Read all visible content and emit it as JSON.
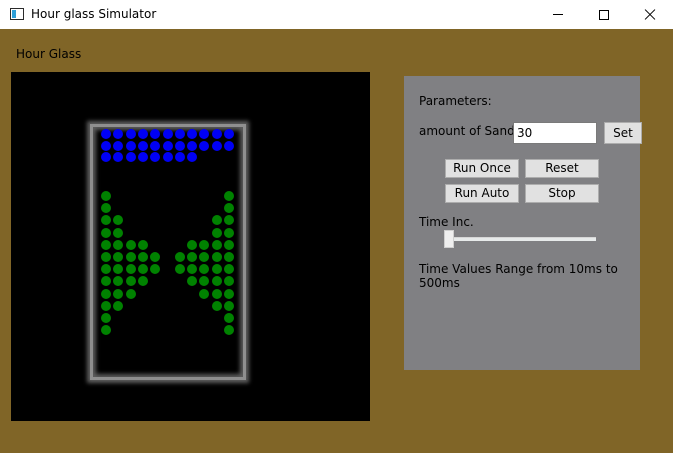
{
  "window": {
    "title": "Hour glass Simulator",
    "icon": "app-window-icon"
  },
  "colors": {
    "background": "#806527",
    "canvas": "#000000",
    "panel": "#808083",
    "sand_top": "#0000f5",
    "sand_pile": "#008200"
  },
  "main": {
    "group_label": "Hour Glass"
  },
  "simulation": {
    "blue_rows": [
      [
        1,
        1,
        1,
        1,
        1,
        1,
        1,
        1,
        1,
        1,
        1
      ],
      [
        1,
        1,
        1,
        1,
        1,
        1,
        1,
        1,
        1,
        1,
        1
      ],
      [
        1,
        1,
        1,
        1,
        1,
        1,
        1,
        1,
        0,
        0,
        0
      ]
    ],
    "green_rows": [
      [
        1,
        0,
        0,
        0,
        0,
        0,
        0,
        0,
        0,
        0,
        1
      ],
      [
        1,
        0,
        0,
        0,
        0,
        0,
        0,
        0,
        0,
        0,
        1
      ],
      [
        1,
        1,
        0,
        0,
        0,
        0,
        0,
        0,
        0,
        1,
        1
      ],
      [
        1,
        1,
        0,
        0,
        0,
        0,
        0,
        0,
        0,
        1,
        1
      ],
      [
        1,
        1,
        1,
        1,
        0,
        0,
        0,
        1,
        1,
        1,
        1
      ],
      [
        1,
        1,
        1,
        1,
        1,
        0,
        1,
        1,
        1,
        1,
        1
      ],
      [
        1,
        1,
        1,
        1,
        1,
        0,
        1,
        1,
        1,
        1,
        1
      ],
      [
        1,
        1,
        1,
        1,
        0,
        0,
        0,
        1,
        1,
        1,
        1
      ],
      [
        1,
        1,
        1,
        0,
        0,
        0,
        0,
        0,
        1,
        1,
        1
      ],
      [
        1,
        1,
        0,
        0,
        0,
        0,
        0,
        0,
        0,
        1,
        1
      ],
      [
        1,
        0,
        0,
        0,
        0,
        0,
        0,
        0,
        0,
        0,
        1
      ],
      [
        1,
        0,
        0,
        0,
        0,
        0,
        0,
        0,
        0,
        0,
        1
      ]
    ]
  },
  "parameters": {
    "title": "Parameters:",
    "sand_label": "amount of Sand:",
    "sand_value": "30",
    "set_label": "Set",
    "run_once_label": "Run Once",
    "reset_label": "Reset",
    "run_auto_label": "Run Auto",
    "stop_label": "Stop",
    "time_label": "Time Inc.",
    "time_slider": {
      "min": 10,
      "max": 500,
      "value": 10
    },
    "range_text": "Time Values Range from 10ms to 500ms"
  }
}
